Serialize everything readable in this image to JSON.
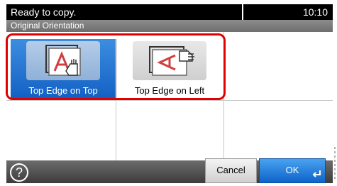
{
  "status": {
    "message": "Ready to copy.",
    "time": "10:10"
  },
  "screen": {
    "title": "Original Orientation"
  },
  "options": [
    {
      "label": "Top Edge on Top",
      "icon": "top-edge-on-top-icon",
      "selected": true
    },
    {
      "label": "Top Edge on Left",
      "icon": "top-edge-on-left-icon",
      "selected": false
    }
  ],
  "footer": {
    "help_label": "?",
    "cancel_label": "Cancel",
    "ok_label": "OK"
  },
  "colors": {
    "accent": "#1b6fd1",
    "selection_border": "#e00000"
  }
}
